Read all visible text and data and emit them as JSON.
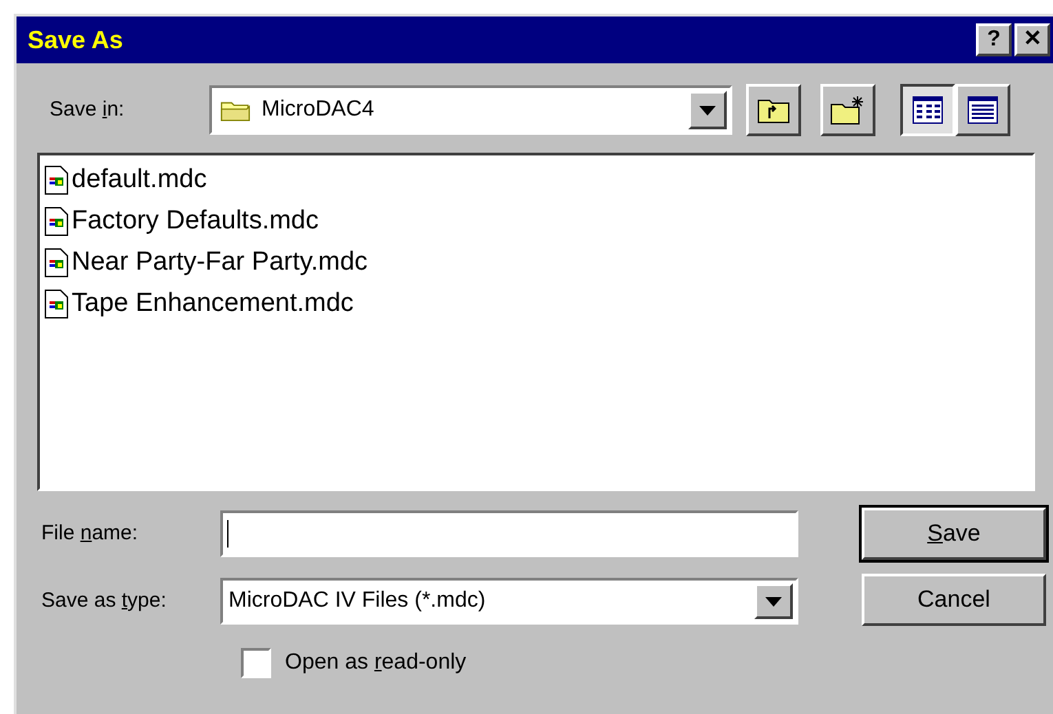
{
  "window": {
    "title": "Save As",
    "title_buttons": [
      "?",
      "✕"
    ]
  },
  "save_in": {
    "label": {
      "before": "Save ",
      "key": "i",
      "after": "n:"
    },
    "value": "MicroDAC4"
  },
  "toolbar": [
    {
      "kind": "up"
    },
    {
      "kind": "new-folder"
    },
    {
      "kind": "list",
      "selected": true
    },
    {
      "kind": "details",
      "selected": false
    }
  ],
  "files": [
    {
      "name": "default.mdc"
    },
    {
      "name": "Factory Defaults.mdc"
    },
    {
      "name": "Near Party-Far Party.mdc"
    },
    {
      "name": "Tape Enhancement.mdc"
    }
  ],
  "file_name": {
    "label": {
      "before": "File ",
      "key": "n",
      "after": "ame:"
    }
  },
  "save_as_type": {
    "label": {
      "before": "Save as ",
      "key": "t",
      "after": "ype:"
    },
    "value": "MicroDAC IV Files (*.mdc)"
  },
  "read_only": {
    "label": {
      "before": "Open as ",
      "key": "r",
      "after": "ead-only"
    },
    "checked": false
  },
  "buttons": [
    {
      "label": {
        "key": "S",
        "after": "ave"
      },
      "default": true
    },
    {
      "label": {
        "before": "Cancel"
      },
      "default": false
    }
  ]
}
